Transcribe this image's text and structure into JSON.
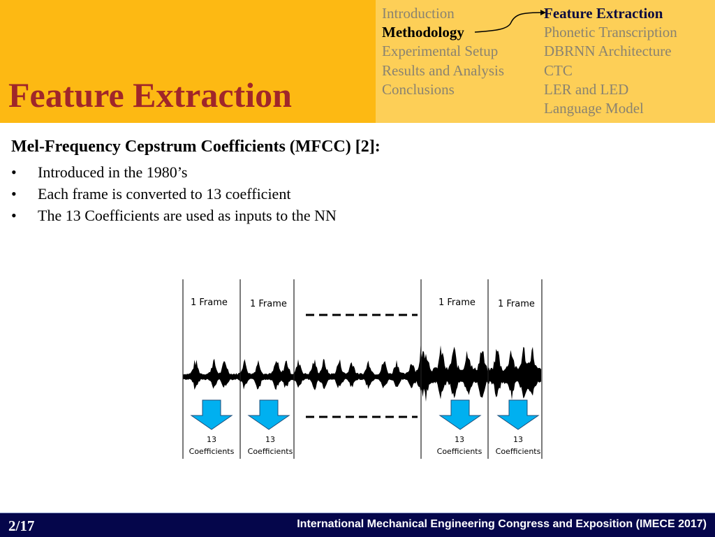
{
  "header": {
    "title": "Feature Extraction",
    "colors": {
      "left_panel": "#FDB913",
      "right_panel": "#FDCF57",
      "title": "#A0262A"
    }
  },
  "nav": {
    "sections": [
      {
        "label": "Introduction",
        "state": "inactive"
      },
      {
        "label": "Methodology",
        "state": "active"
      },
      {
        "label": "Experimental Setup",
        "state": "inactive"
      },
      {
        "label": "Results and Analysis",
        "state": "inactive"
      },
      {
        "label": "Conclusions",
        "state": "inactive"
      }
    ],
    "subsections": [
      {
        "label": "Feature Extraction",
        "state": "current"
      },
      {
        "label": "Phonetic Transcription",
        "state": "inactive"
      },
      {
        "label": "DBRNN Architecture",
        "state": "inactive"
      },
      {
        "label": "CTC",
        "state": "inactive"
      },
      {
        "label": "LER and LED",
        "state": "inactive"
      },
      {
        "label": "Language Model",
        "state": "inactive"
      }
    ]
  },
  "content": {
    "heading": "Mel-Frequency Cepstrum Coefficients (MFCC) [2]:",
    "bullet_glyph": "•",
    "bullets": [
      "Introduced in the 1980’s",
      "Each frame is converted to 13 coefficient",
      "The 13 Coefficients are used as inputs to the NN"
    ]
  },
  "diagram": {
    "frames": [
      {
        "label": "1 Frame",
        "count": "13",
        "coef_label": "Coefficients"
      },
      {
        "label": "1 Frame",
        "count": "13",
        "coef_label": "Coefficients"
      },
      {
        "label": "1 Frame",
        "count": "13",
        "coef_label": "Coefficients"
      },
      {
        "label": "1 Frame",
        "count": "13",
        "coef_label": "Coefficients"
      }
    ],
    "arrow_color": "#00B0F0"
  },
  "footer": {
    "page": "2/17",
    "conference": "International Mechanical Engineering Congress and Exposition (IMECE 2017)",
    "background": "#05064B"
  }
}
